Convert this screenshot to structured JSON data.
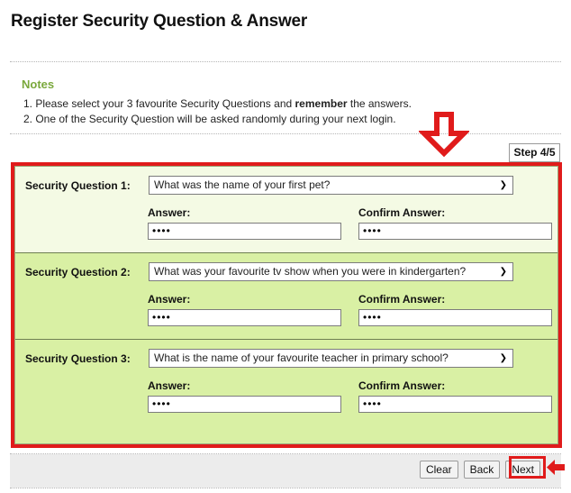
{
  "page": {
    "title": "Register Security Question & Answer"
  },
  "notes": {
    "heading": "Notes",
    "items": [
      {
        "prefix": "1. Please select your 3 favourite Security Questions and ",
        "emphasis": "remember",
        "suffix": " the answers."
      },
      {
        "prefix": "2. One of the Security Question will be asked randomly during your next login.",
        "emphasis": "",
        "suffix": ""
      }
    ]
  },
  "step": {
    "label": "Step 4/5"
  },
  "form": {
    "answer_label": "Answer:",
    "confirm_label": "Confirm Answer:",
    "dropdown_icon": "chevron-down-icon",
    "rows": [
      {
        "label": "Security Question 1:",
        "selected_question": "What was the name of your first pet?",
        "answer_value": "••••",
        "confirm_value": "••••"
      },
      {
        "label": "Security Question 2:",
        "selected_question": "What was your favourite tv show when you were in kindergarten?",
        "answer_value": "••••",
        "confirm_value": "••••"
      },
      {
        "label": "Security Question 3:",
        "selected_question": "What is the name of your favourite teacher in primary school?",
        "answer_value": "••••",
        "confirm_value": "••••"
      }
    ]
  },
  "footer": {
    "clear_label": "Clear",
    "back_label": "Back",
    "next_label": "Next"
  },
  "annotations": {
    "color": "#e01b1b",
    "arrow_down_icon": "arrow-down-outline-icon",
    "arrow_left_icon": "arrow-left-solid-icon"
  },
  "colors": {
    "notes_heading": "#7aa83c",
    "row_light": "#f4fae4",
    "row_green": "#d9f0a4",
    "annotation_red": "#e01b1b",
    "footer_bg": "#ececec"
  }
}
